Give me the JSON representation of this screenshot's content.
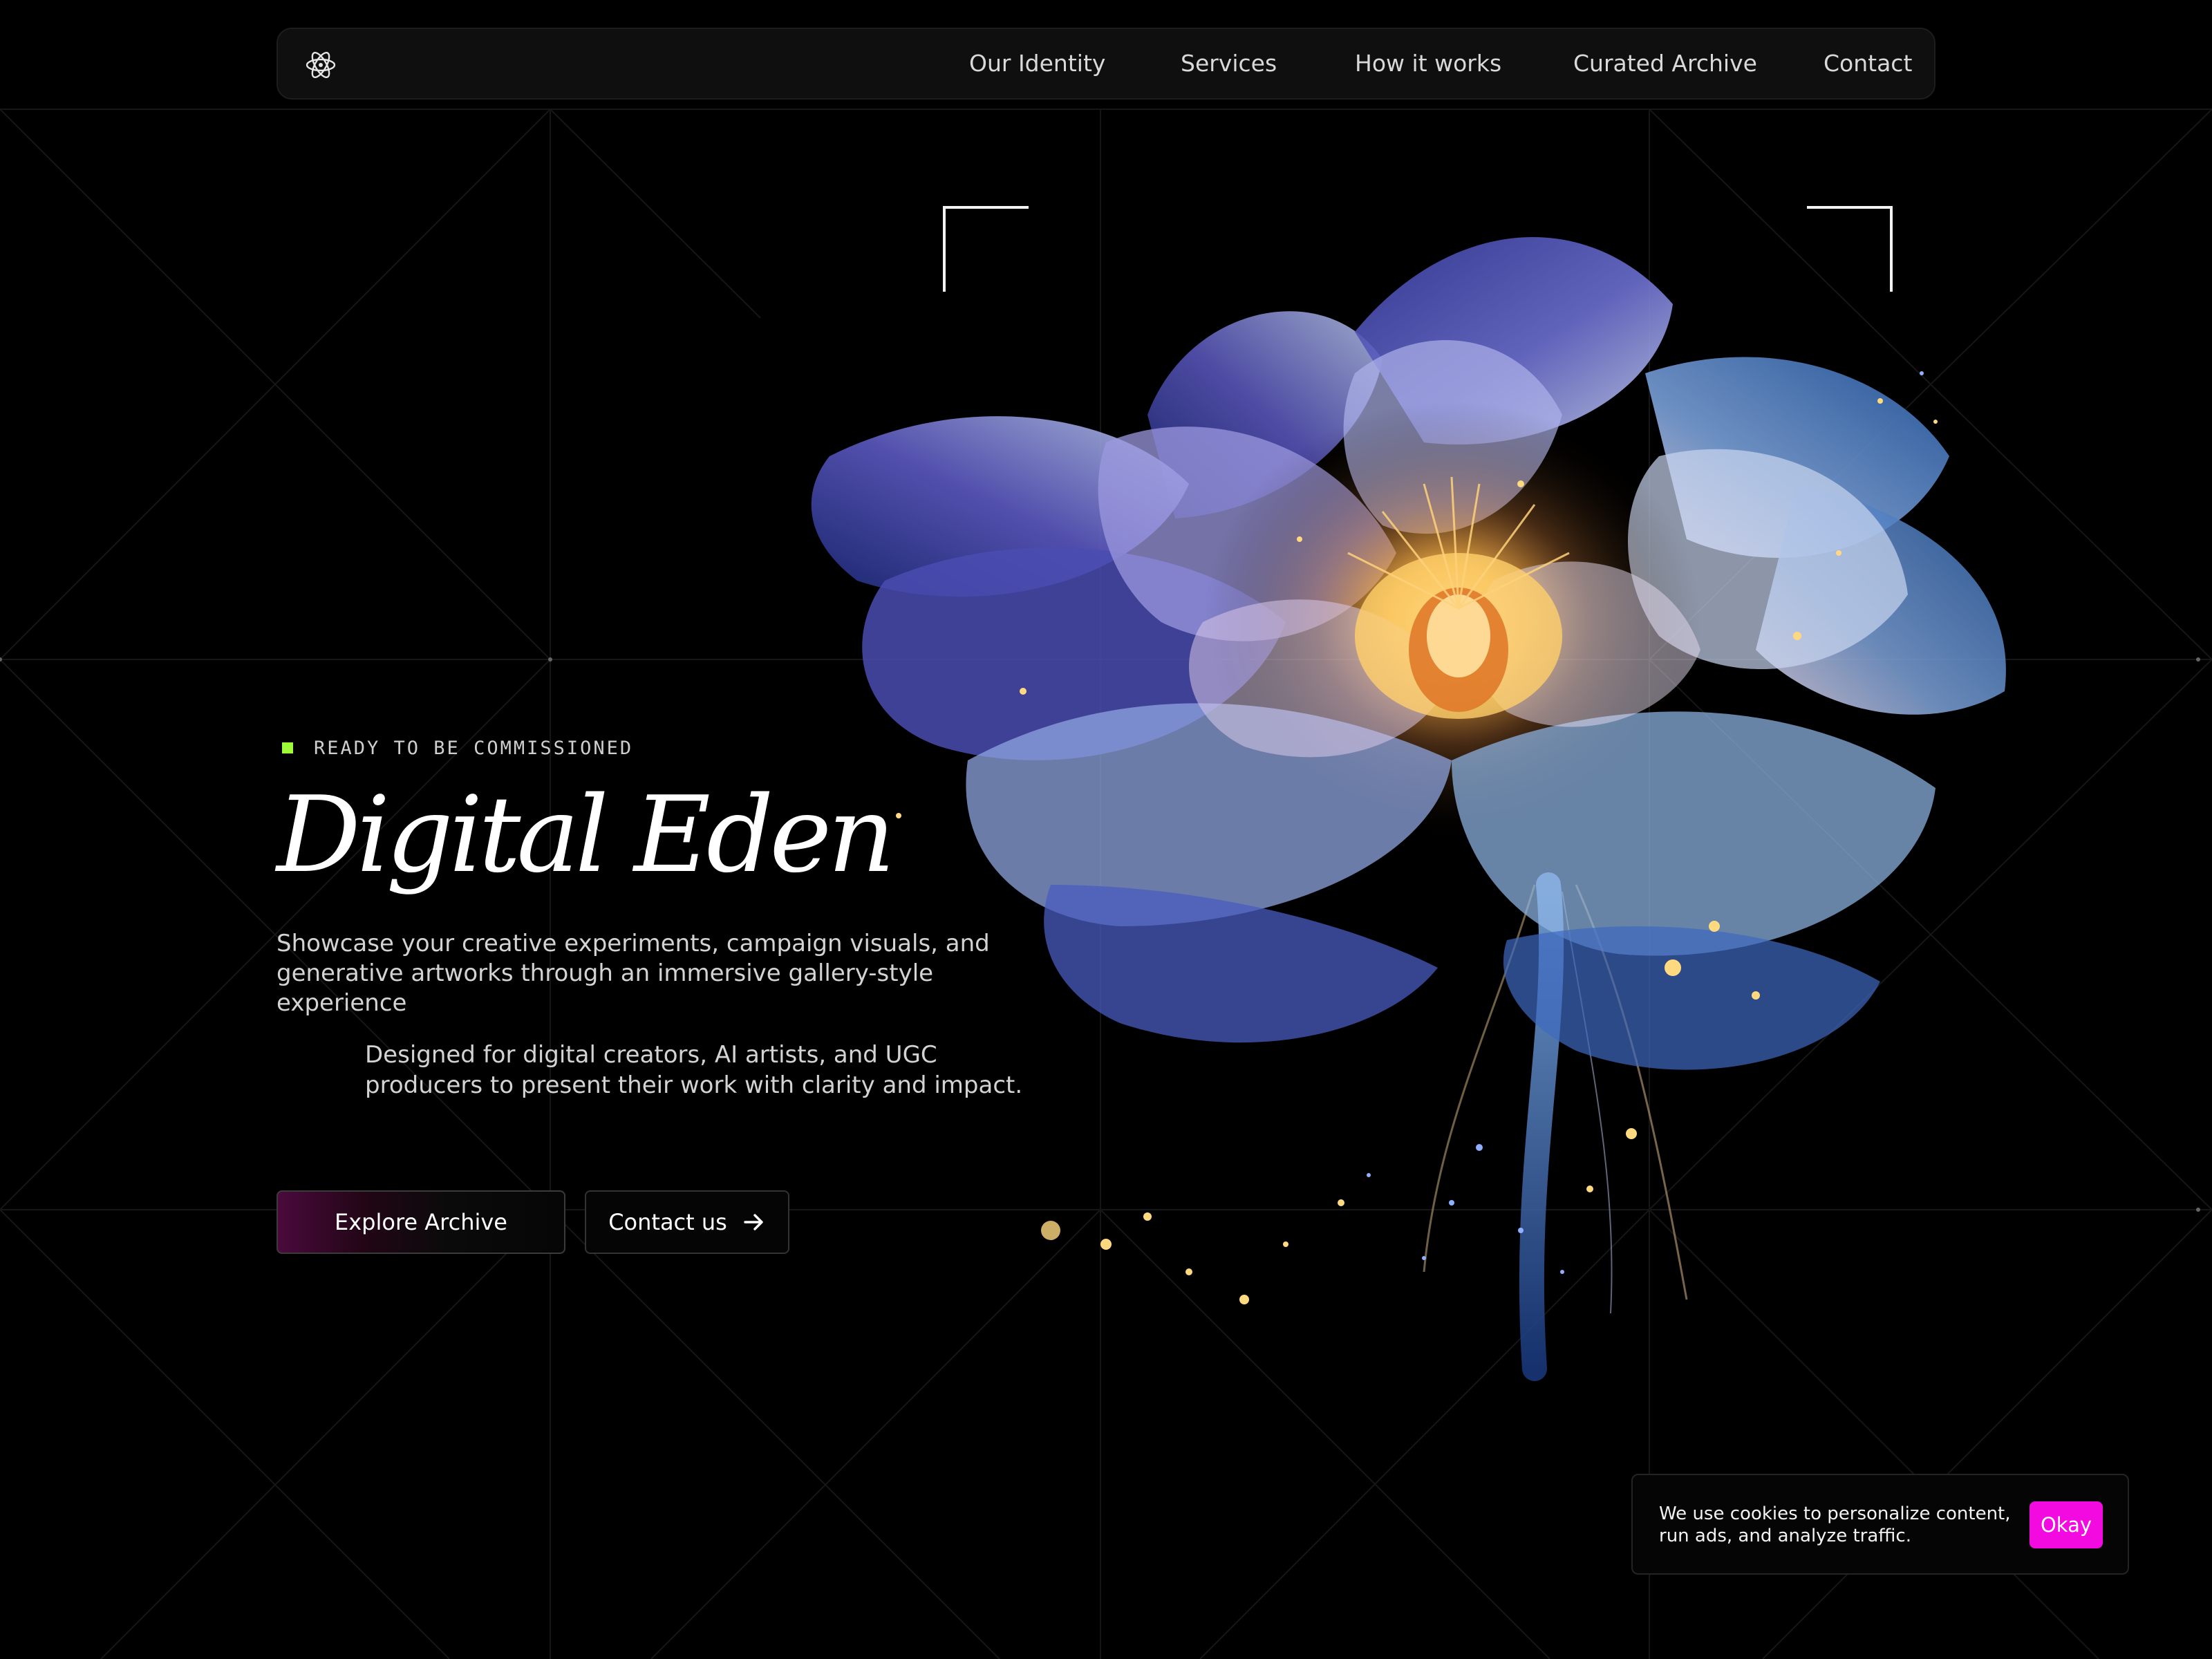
{
  "nav": {
    "logo_icon": "atom-icon",
    "links": [
      "Our Identity",
      "Services",
      "How it works",
      "Curated Archive",
      "Contact"
    ]
  },
  "hero": {
    "status": "READY TO BE COMMISSIONED",
    "status_color": "#9dfb3a",
    "title": "Digital Eden",
    "description": "Showcase your creative experiments, campaign visuals, and generative artworks through an immersive gallery-style experience",
    "sub_description": "Designed for digital creators, AI artists, and UGC producers to present their work with clarity and impact.",
    "primary_button": "Explore Archive",
    "secondary_button": "Contact us",
    "secondary_icon": "arrow-right-icon"
  },
  "cookie": {
    "text": "We use cookies to personalize content, run ads, and analyze traffic.",
    "button": "Okay",
    "button_color": "#f20ae0"
  }
}
